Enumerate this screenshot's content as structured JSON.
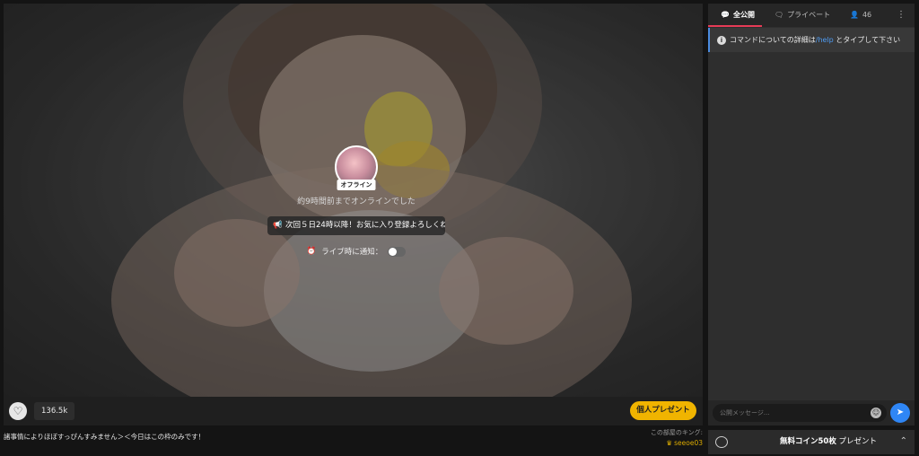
{
  "video": {
    "offline_tag": "オフライン",
    "last_online": "約9時間前までオンラインでした",
    "announcement": "次回５日24時以降！お気に入り登録よろしくね",
    "notify_label": "ライブ時に通知："
  },
  "player_bar": {
    "views": "136.5k",
    "gift_button": "個人プレゼント"
  },
  "caption": "諸事情によりほぼすっぴんすみません＞＜今日はこの枠のみです！",
  "king": {
    "label": "この部屋のキング:",
    "name": "seeoe03"
  },
  "chat": {
    "tabs": [
      {
        "label": "全公開",
        "icon": "chat-bubble-icon"
      },
      {
        "label": "プライベート",
        "icon": "private-chat-icon"
      },
      {
        "label": "46",
        "icon": "user-icon"
      }
    ],
    "system_message_pre": "コマンドについての詳細は",
    "system_message_cmd": "/help",
    "system_message_post": " とタイプして下さい",
    "input_placeholder": "公開メッセージ..."
  },
  "coin_bar": {
    "bold_text": "無料コイン50枚",
    "text": " プレゼント"
  },
  "colors": {
    "accent_gift": "#f0b400",
    "tab_underline": "#e63b56",
    "send_button": "#2f86f5",
    "help_link": "#4f9cf2"
  }
}
